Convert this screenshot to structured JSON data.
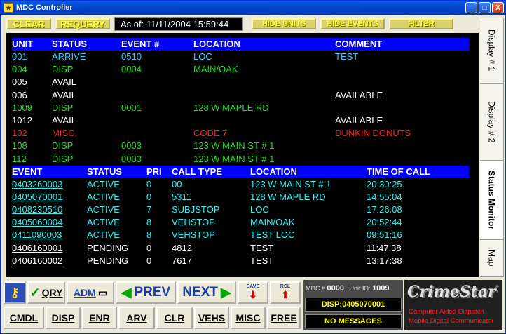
{
  "window": {
    "title": "MDC Controller",
    "minimize": "_",
    "maximize": "□",
    "close": "X"
  },
  "toolbar": {
    "clear": "CLEAR",
    "requery": "REQUERY",
    "as_of": "As of: 11/11/2004 15:59:44",
    "hide_units": "HIDE UNITS",
    "hide_events": "HIDE EVENTS",
    "filter": "FILTER"
  },
  "units": {
    "headers": [
      "UNIT",
      "STATUS",
      "EVENT #",
      "LOCATION",
      "COMMENT"
    ],
    "rows": [
      {
        "unit": "001",
        "status": "ARRIVE",
        "event": "0510",
        "location": "LOC",
        "comment": "TEST",
        "color": "#33ccff"
      },
      {
        "unit": "004",
        "status": "DISP",
        "event": "0004",
        "location": "MAIN/OAK",
        "comment": "",
        "color": "#22dd22"
      },
      {
        "unit": "005",
        "status": "AVAIL",
        "event": "",
        "location": "",
        "comment": "",
        "color": "#ffffff"
      },
      {
        "unit": "006",
        "status": "AVAIL",
        "event": "",
        "location": "",
        "comment": "AVAILABLE",
        "color": "#ffffff"
      },
      {
        "unit": "1009",
        "status": "DISP",
        "event": "0001",
        "location": "128 W MAPLE RD",
        "comment": "",
        "color": "#22dd22"
      },
      {
        "unit": "1012",
        "status": "AVAIL",
        "event": "",
        "location": "",
        "comment": "AVAILABLE",
        "color": "#ffffff"
      },
      {
        "unit": "102",
        "status": "MISC.",
        "event": "",
        "location": "CODE 7",
        "comment": "DUNKIN DONUTS",
        "color": "#ff2020"
      },
      {
        "unit": "108",
        "status": "DISP",
        "event": "0003",
        "location": "123 W MAIN ST # 1",
        "comment": "",
        "color": "#22dd22"
      },
      {
        "unit": "112",
        "status": "DISP",
        "event": "0003",
        "location": "123 W MAIN ST # 1",
        "comment": "",
        "color": "#22dd22"
      }
    ]
  },
  "events": {
    "headers": [
      "EVENT",
      "STATUS",
      "PRI",
      "CALL TYPE",
      "LOCATION",
      "TIME OF CALL"
    ],
    "rows": [
      {
        "event": "0403260003",
        "status": "ACTIVE",
        "pri": "0",
        "call_type": "00",
        "location": "123 W MAIN ST # 1",
        "time": "20:30:25",
        "color": "#33eeee"
      },
      {
        "event": "0405070001",
        "status": "ACTIVE",
        "pri": "0",
        "call_type": "5311",
        "location": "128 W MAPLE RD",
        "time": "14:55:04",
        "color": "#33eeee"
      },
      {
        "event": "0408230510",
        "status": "ACTIVE",
        "pri": "7",
        "call_type": "SUBJSTOP",
        "location": "LOC",
        "time": "17:26:08",
        "color": "#33eeee"
      },
      {
        "event": "0405060004",
        "status": "ACTIVE",
        "pri": "8",
        "call_type": "VEHSTOP",
        "location": "MAIN/OAK",
        "time": "20:52:44",
        "color": "#33eeee"
      },
      {
        "event": "0411090003",
        "status": "ACTIVE",
        "pri": "8",
        "call_type": "VEHSTOP",
        "location": "TEST LOC",
        "time": "09:51:16",
        "color": "#33eeee"
      },
      {
        "event": "0406160001",
        "status": "PENDING",
        "pri": "0",
        "call_type": "4812",
        "location": "TEST",
        "time": "11:47:38",
        "color": "#ffffff"
      },
      {
        "event": "0406160002",
        "status": "PENDING",
        "pri": "0",
        "call_type": "7617",
        "location": "TEST",
        "time": "13:17:38",
        "color": "#ffffff"
      }
    ]
  },
  "tabs": [
    "Display # 1",
    "Display # 2",
    "Status Monitor",
    "Map"
  ],
  "buttons": {
    "qry": "QRY",
    "adm": "ADM",
    "prev": "PREV",
    "next": "NEXT",
    "save": "SAVE",
    "rcl": "RCL",
    "cmdl": "CMDL",
    "disp": "DISP",
    "enr": "ENR",
    "arv": "ARV",
    "clr": "CLR",
    "vehs": "VEHS",
    "misc": "MISC",
    "free": "FREE"
  },
  "mdc": {
    "mdc_label": "MDC #",
    "mdc_num": "0000",
    "unit_label": "Unit ID:",
    "unit_id": "1009",
    "disp": "DISP:0405070001",
    "messages": "NO MESSAGES"
  },
  "logo": {
    "name": "CrimeStar",
    "tm": "®",
    "line1": "Computer Aided Dispatch",
    "line2": "Mobile Digital Communicator"
  }
}
